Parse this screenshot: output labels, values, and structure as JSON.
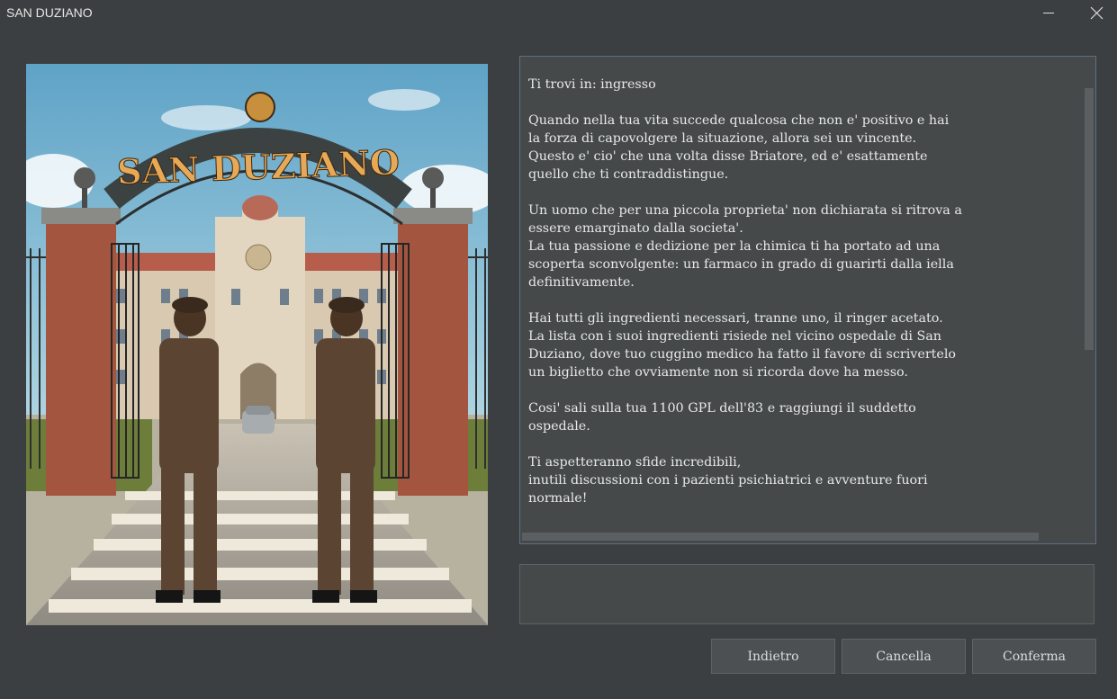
{
  "window": {
    "title": "SAN DUZIANO",
    "controls": [
      "minimize-icon",
      "close-icon"
    ]
  },
  "scene": {
    "sign_text": "SAN DUZIANO"
  },
  "story": {
    "text": "Ti trovi in: ingresso\n\nQuando nella tua vita succede qualcosa che non e' positivo e hai\nla forza di capovolgere la situazione, allora sei un vincente.\nQuesto e' cio' che una volta disse Briatore, ed e' esattamente\nquello che ti contraddistingue.\n\nUn uomo che per una piccola proprieta' non dichiarata si ritrova a\nessere emarginato dalla societa'.\nLa tua passione e dedizione per la chimica ti ha portato ad una\nscoperta sconvolgente: un farmaco in grado di guarirti dalla iella\ndefinitivamente.\n\nHai tutti gli ingredienti necessari, tranne uno, il ringer acetato.\nLa lista con i suoi ingredienti risiede nel vicino ospedale di San\nDuziano, dove tuo cuggino medico ha fatto il favore di scrivertelo\nun biglietto che ovviamente non si ricorda dove ha messo.\n\nCosi' sali sulla tua 1100 GPL dell'83 e raggiungi il suddetto\nospedale.\n\nTi aspetteranno sfide incredibili,\ninutili discussioni con i pazienti psichiatrici e avventure fuori\nnormale!"
  },
  "input": {
    "value": ""
  },
  "buttons": {
    "back": "Indietro",
    "clear": "Cancella",
    "confirm": "Conferma"
  }
}
